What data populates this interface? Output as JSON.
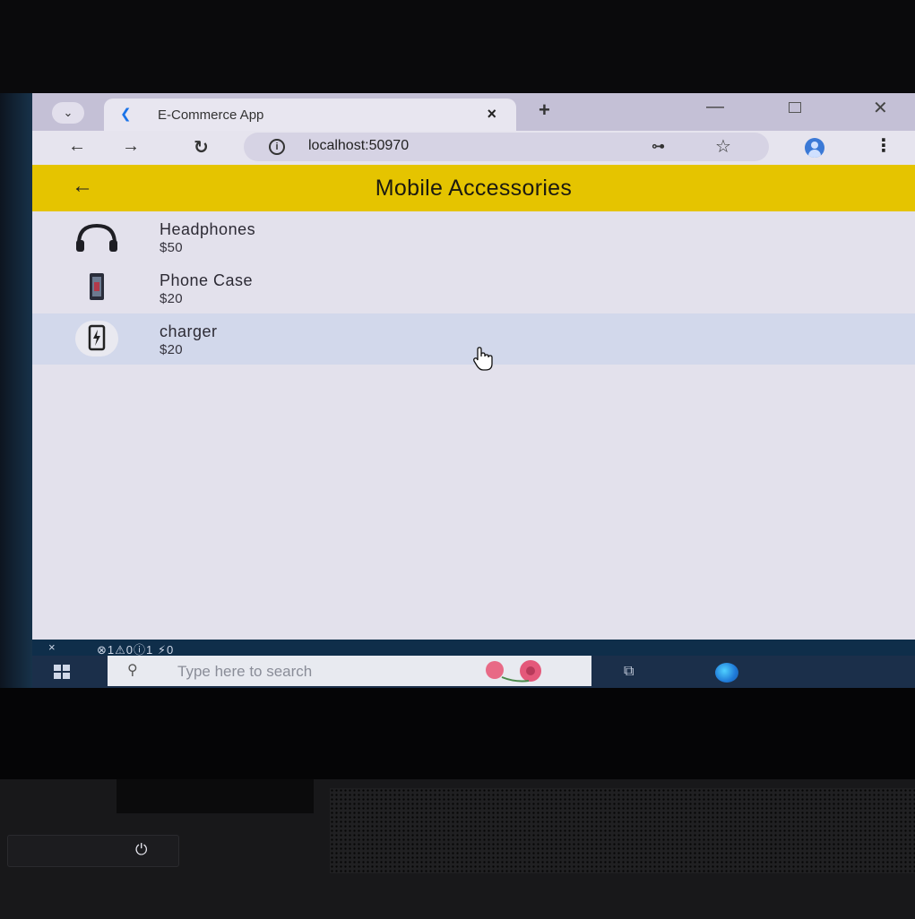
{
  "browser": {
    "tab_title": "E-Commerce App",
    "new_tab": "+",
    "tab_close": "×",
    "url": "localhost:50970"
  },
  "app": {
    "title": "Mobile Accessories",
    "items": [
      {
        "name": "Headphones",
        "price": "$50",
        "icon": "headphones-icon"
      },
      {
        "name": "Phone Case",
        "price": "$20",
        "icon": "phone-case-icon"
      },
      {
        "name": "charger",
        "price": "$20",
        "icon": "charger-icon",
        "hovered": true
      }
    ]
  },
  "status_bar": {
    "close": "×",
    "diagnostics": "⊗1⚠0ⓘ1  ⚡0"
  },
  "taskbar": {
    "search_placeholder": "Type here to search"
  },
  "colors": {
    "appbar": "#e5c400",
    "list_background": "#e3e1ec",
    "hover_row": "#d2d8eb",
    "taskbar": "#1b2f4a"
  }
}
